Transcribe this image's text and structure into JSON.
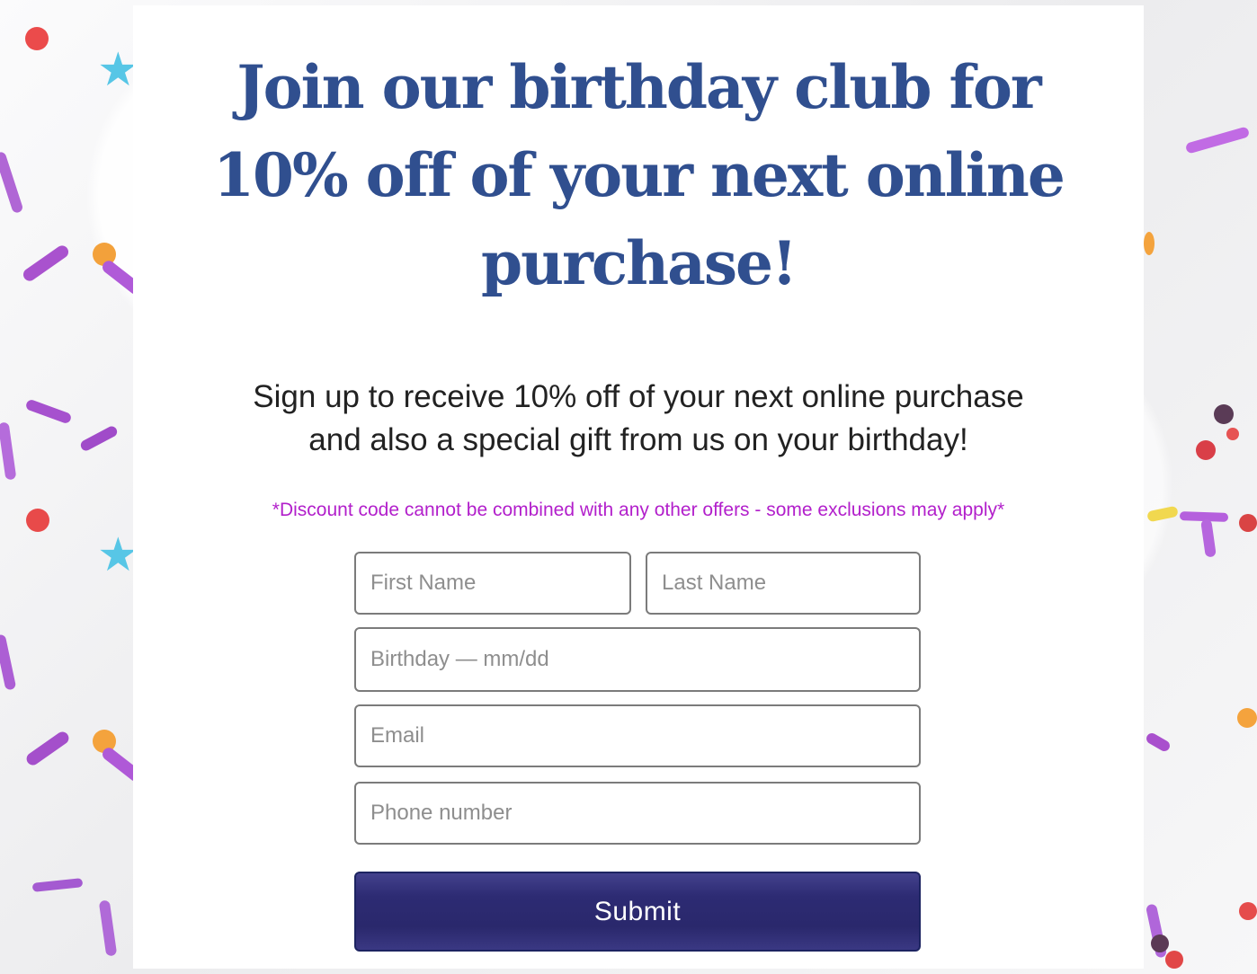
{
  "headline": {
    "line1": "Join our birthday club for",
    "line2": "10% off of your next online",
    "line3": "purchase!"
  },
  "subheading": {
    "line1": "Sign up to receive 10% off of your next online purchase",
    "line2": "and also a special gift from us on your birthday!"
  },
  "disclaimer": "*Discount code cannot be combined with any other offers - some exclusions may apply*",
  "form": {
    "first_name_placeholder": "First Name",
    "last_name_placeholder": "Last Name",
    "birthday_placeholder": "Birthday — mm/dd",
    "email_placeholder": "Email",
    "phone_placeholder": "Phone number",
    "submit_label": "Submit"
  },
  "colors": {
    "headline": "#304f8f",
    "disclaimer": "#b21fcb",
    "submit": "#2d2b73"
  }
}
